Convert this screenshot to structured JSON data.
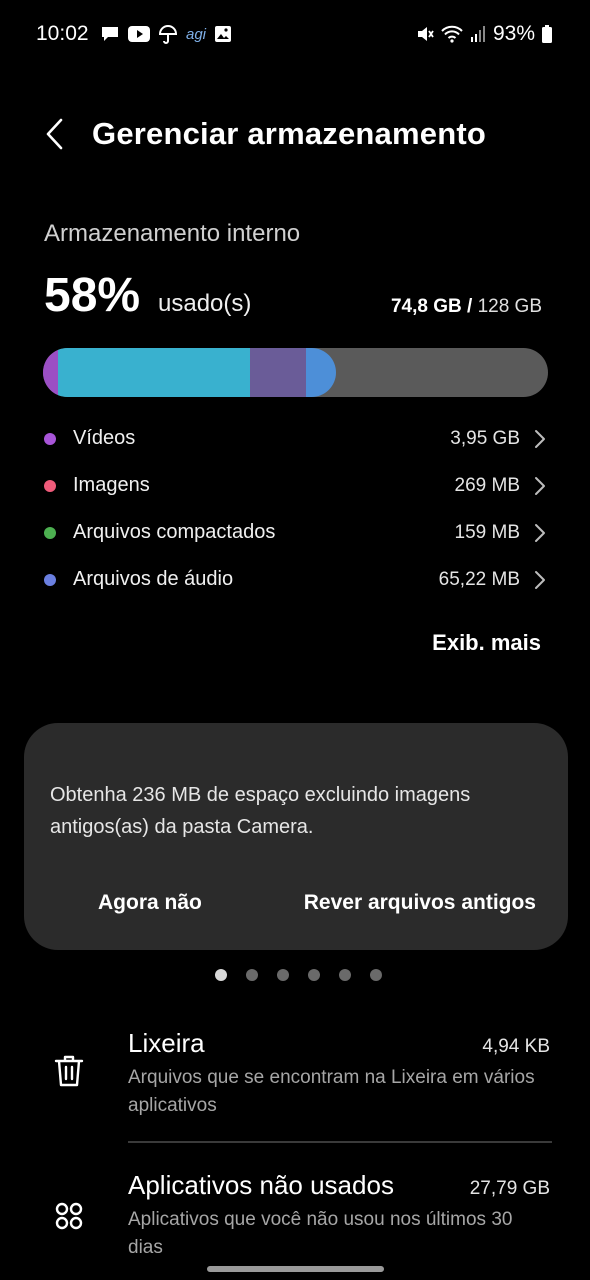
{
  "status_bar": {
    "time": "10:02",
    "notification_icons": [
      "chat-icon",
      "youtube-icon",
      "umbrella-icon",
      "agi-text-icon",
      "gallery-icon"
    ],
    "agi_label": "agi",
    "battery": "93%"
  },
  "header": {
    "title": "Gerenciar armazenamento"
  },
  "storage": {
    "section_label": "Armazenamento interno",
    "percent_used": "58%",
    "used_word": "usado(s)",
    "used_amount": "74,8 GB",
    "separator": " / ",
    "total_amount": "128 GB",
    "bar_segments": [
      {
        "name": "videos",
        "color": "#9b4fc4",
        "fraction": 0.03
      },
      {
        "name": "imagens",
        "color": "#39b1cf",
        "fraction": 0.38
      },
      {
        "name": "compactados",
        "color": "#6a5c98",
        "fraction": 0.11
      },
      {
        "name": "audio",
        "color": "#4d8fd8",
        "fraction": 0.06
      }
    ],
    "bar_track_color": "#5a5a5a"
  },
  "categories": [
    {
      "label": "Vídeos",
      "size": "3,95 GB",
      "color": "#a855d8"
    },
    {
      "label": "Imagens",
      "size": "269 MB",
      "color": "#ef5b7a"
    },
    {
      "label": "Arquivos compactados",
      "size": "159 MB",
      "color": "#4caf50"
    },
    {
      "label": "Arquivos de áudio",
      "size": "65,22 MB",
      "color": "#6a7fe0"
    }
  ],
  "see_more_label": "Exib. mais",
  "suggestion": {
    "text": "Obtenha 236 MB de espaço excluindo imagens antigos(as) da pasta Camera.",
    "dismiss_label": "Agora não",
    "action_label": "Rever arquivos antigos"
  },
  "pager": {
    "count": 6,
    "active_index": 0
  },
  "tools": [
    {
      "title": "Lixeira",
      "size": "4,94 KB",
      "description": "Arquivos que se encontram na Lixeira em vários aplicativos",
      "icon": "trash-icon"
    },
    {
      "title": "Aplicativos não usados",
      "size": "27,79 GB",
      "description": "Aplicativos que você não usou nos últimos 30 dias",
      "icon": "apps-icon"
    }
  ]
}
